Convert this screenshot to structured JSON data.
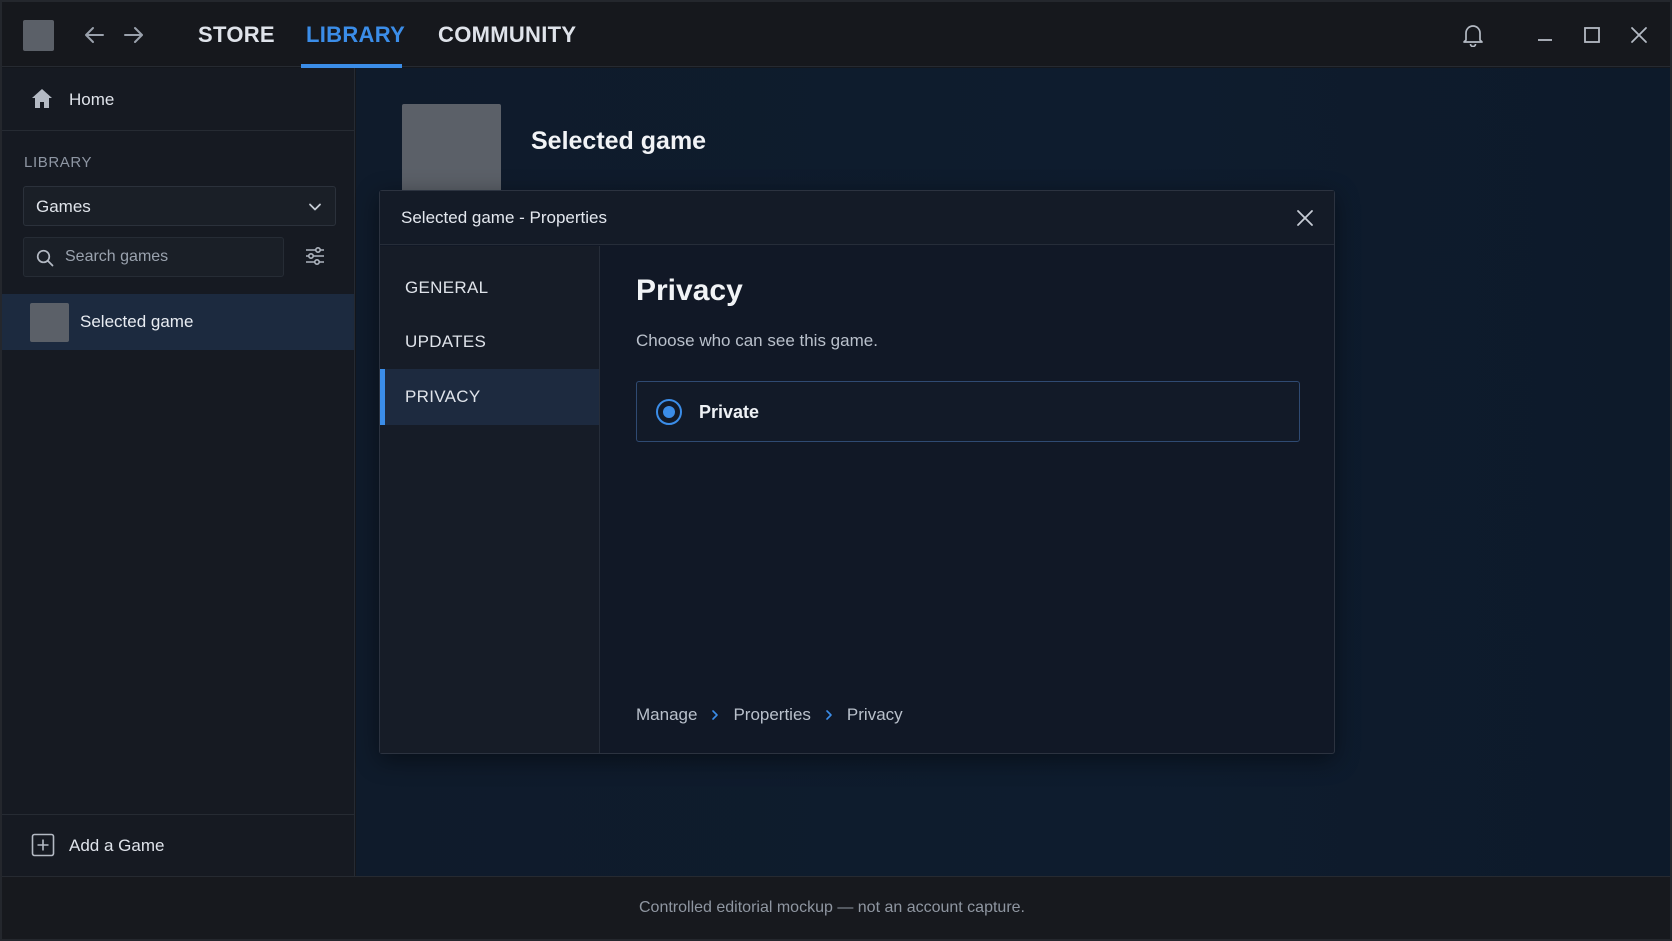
{
  "titlebar": {
    "tabs": [
      {
        "label": "STORE",
        "active": false
      },
      {
        "label": "LIBRARY",
        "active": true
      },
      {
        "label": "COMMUNITY",
        "active": false
      }
    ],
    "icons": {
      "back": "arrow-left-icon",
      "forward": "arrow-right-icon",
      "notifications": "bell-icon",
      "minimize": "minimize-icon",
      "maximize": "maximize-icon",
      "close": "close-icon"
    }
  },
  "sidebar": {
    "home_label": "Home",
    "section_label": "LIBRARY",
    "filter_select": {
      "value": "Games"
    },
    "search": {
      "placeholder": "Search games",
      "value": ""
    },
    "games": [
      {
        "label": "Selected game",
        "selected": true
      }
    ],
    "add_game_label": "Add a Game"
  },
  "main": {
    "hero_title": "Selected game"
  },
  "dialog": {
    "title": "Selected game - Properties",
    "nav": [
      {
        "label": "GENERAL",
        "active": false
      },
      {
        "label": "UPDATES",
        "active": false
      },
      {
        "label": "PRIVACY",
        "active": true
      }
    ],
    "content": {
      "heading": "Privacy",
      "description": "Choose who can see this game.",
      "options": [
        {
          "label": "Private",
          "checked": true
        }
      ],
      "breadcrumb": [
        "Manage",
        "Properties",
        "Privacy"
      ]
    }
  },
  "footer": {
    "text": "Controlled editorial mockup — not an account capture."
  },
  "colors": {
    "accent": "#3b8de8",
    "background": "#14171d",
    "main_bg": "#0e1c2e",
    "selected_row": "#1c2a3f"
  }
}
